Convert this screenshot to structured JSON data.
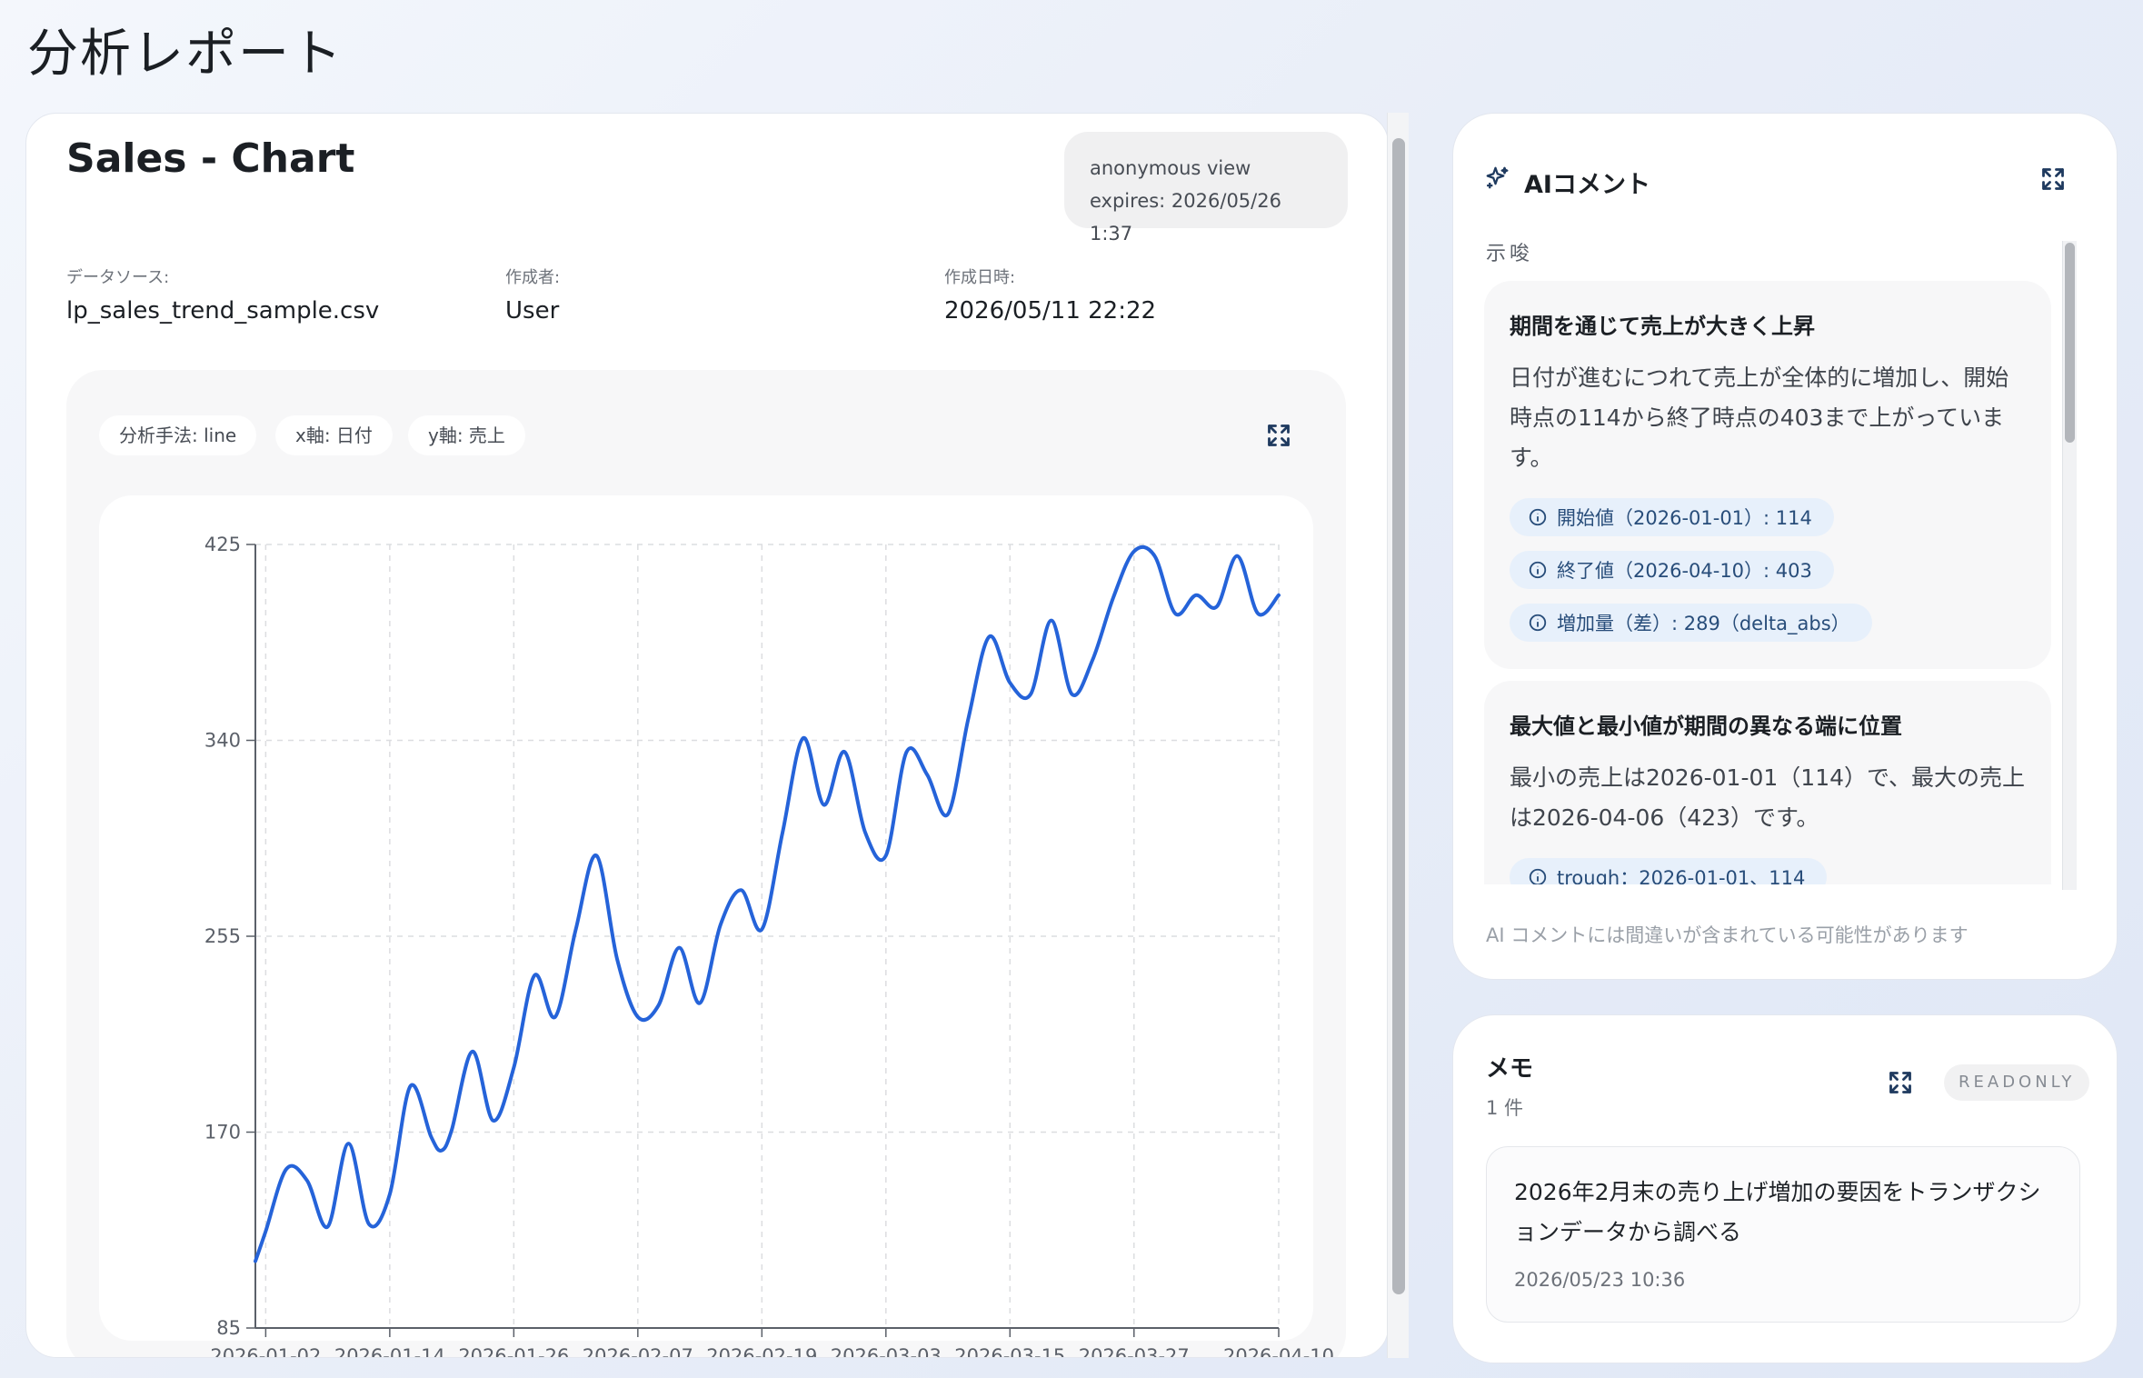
{
  "page": {
    "title": "分析レポート"
  },
  "report": {
    "heading": "Sales - Chart",
    "anon": {
      "line1": "anonymous view",
      "line2": "expires: 2026/05/26 1:37"
    },
    "meta": [
      {
        "label": "データソース:",
        "value": "lp_sales_trend_sample.csv"
      },
      {
        "label": "作成者:",
        "value": "User"
      },
      {
        "label": "作成日時:",
        "value": "2026/05/11 22:22"
      }
    ],
    "chips": [
      "分析手法: line",
      "x軸: 日付",
      "y軸: 売上"
    ]
  },
  "chart_data": {
    "type": "line",
    "title": "",
    "xlabel": "",
    "ylabel": "",
    "x_ticks": [
      "2026-01-02",
      "2026-01-14",
      "2026-01-26",
      "2026-02-07",
      "2026-02-19",
      "2026-03-03",
      "2026-03-15",
      "2026-03-27",
      "2026-04-10"
    ],
    "y_ticks": [
      425,
      340,
      255,
      170,
      85
    ],
    "ylim": [
      85,
      425
    ],
    "xlim": [
      "2026-01-01",
      "2026-04-10"
    ],
    "grid": true,
    "legend": "bottom",
    "series": [
      {
        "name": "売上",
        "color": "#2563d9",
        "x": [
          "2026-01-01",
          "2026-01-02",
          "2026-01-04",
          "2026-01-06",
          "2026-01-08",
          "2026-01-10",
          "2026-01-12",
          "2026-01-14",
          "2026-01-16",
          "2026-01-18",
          "2026-01-19",
          "2026-01-20",
          "2026-01-22",
          "2026-01-24",
          "2026-01-26",
          "2026-01-28",
          "2026-01-30",
          "2026-02-01",
          "2026-02-03",
          "2026-02-05",
          "2026-02-07",
          "2026-02-09",
          "2026-02-11",
          "2026-02-13",
          "2026-02-15",
          "2026-02-17",
          "2026-02-19",
          "2026-02-21",
          "2026-02-23",
          "2026-02-25",
          "2026-02-27",
          "2026-03-01",
          "2026-03-03",
          "2026-03-05",
          "2026-03-07",
          "2026-03-09",
          "2026-03-11",
          "2026-03-13",
          "2026-03-15",
          "2026-03-17",
          "2026-03-19",
          "2026-03-21",
          "2026-03-23",
          "2026-03-25",
          "2026-03-27",
          "2026-03-29",
          "2026-03-31",
          "2026-04-02",
          "2026-04-04",
          "2026-04-06",
          "2026-04-08",
          "2026-04-10"
        ],
        "y": [
          114,
          127,
          154,
          149,
          129,
          165,
          130,
          143,
          190,
          168,
          162,
          171,
          205,
          175,
          198,
          238,
          220,
          258,
          290,
          245,
          220,
          225,
          250,
          226,
          260,
          275,
          258,
          300,
          341,
          312,
          335,
          300,
          290,
          335,
          325,
          308,
          350,
          385,
          365,
          360,
          392,
          360,
          375,
          402,
          422,
          420,
          395,
          403,
          398,
          420,
          395,
          403
        ]
      }
    ]
  },
  "ai": {
    "title": "AIコメント",
    "section": "示唆",
    "disclaimer": "AI コメントには間違いが含まれている可能性があります",
    "insights": [
      {
        "title": "期間を通じて売上が大きく上昇",
        "body": "日付が進むにつれて売上が全体的に増加し、開始時点の114から終了時点の403まで上がっています。",
        "tags": [
          "開始値（2026-01-01）: 114",
          "終了値（2026-04-10）: 403",
          "増加量（差）: 289（delta_abs）"
        ]
      },
      {
        "title": "最大値と最小値が期間の異なる端に位置",
        "body": "最小の売上は2026-01-01（114）で、最大の売上は2026-04-06（423）です。",
        "tags": [
          "trough：2026-01-01、114"
        ]
      }
    ]
  },
  "memo": {
    "title": "メモ",
    "count": "1 件",
    "readonly": "READONLY",
    "note": {
      "text": "2026年2月末の売り上げ増加の要因をトランザクションデータから調べる",
      "time": "2026/05/23 10:36"
    }
  }
}
